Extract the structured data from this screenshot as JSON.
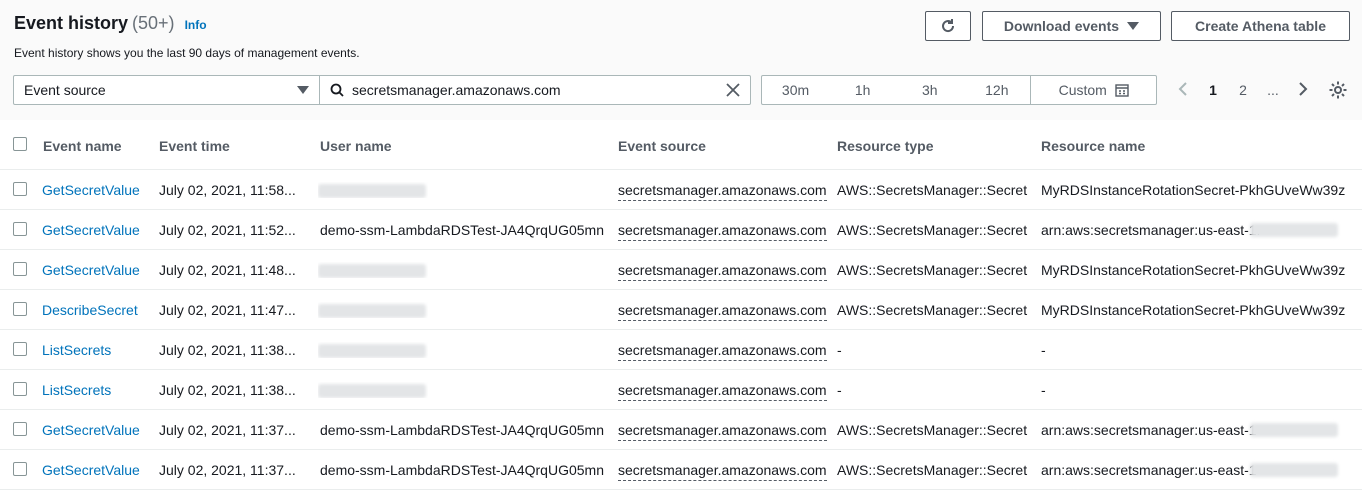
{
  "header": {
    "title": "Event history",
    "count": "(50+)",
    "info": "Info",
    "subtitle": "Event history shows you the last 90 days of management events.",
    "download_label": "Download events",
    "athena_label": "Create Athena table"
  },
  "filter": {
    "attribute": "Event source",
    "search_value": "secretsmanager.amazonaws.com"
  },
  "time_range": [
    "30m",
    "1h",
    "3h",
    "12h",
    "Custom"
  ],
  "pagination": {
    "pages": [
      "1",
      "2",
      "..."
    ],
    "current": "1"
  },
  "table": {
    "columns": [
      "Event name",
      "Event time",
      "User name",
      "Event source",
      "Resource type",
      "Resource name"
    ],
    "rows": [
      {
        "event_name": "GetSecretValue",
        "event_time": "July 02, 2021, 11:58...",
        "user_name": "",
        "event_source": "secretsmanager.amazonaws.com",
        "resource_type": "AWS::SecretsManager::Secret",
        "resource_name": "MyRDSInstanceRotationSecret-PkhGUveWw39z"
      },
      {
        "event_name": "GetSecretValue",
        "event_time": "July 02, 2021, 11:52...",
        "user_name": "demo-ssm-LambdaRDSTest-JA4QrqUG05mn",
        "event_source": "secretsmanager.amazonaws.com",
        "resource_type": "AWS::SecretsManager::Secret",
        "resource_name": "arn:aws:secretsmanager:us-east-1:"
      },
      {
        "event_name": "GetSecretValue",
        "event_time": "July 02, 2021, 11:48...",
        "user_name": "",
        "event_source": "secretsmanager.amazonaws.com",
        "resource_type": "AWS::SecretsManager::Secret",
        "resource_name": "MyRDSInstanceRotationSecret-PkhGUveWw39z"
      },
      {
        "event_name": "DescribeSecret",
        "event_time": "July 02, 2021, 11:47...",
        "user_name": "",
        "event_source": "secretsmanager.amazonaws.com",
        "resource_type": "AWS::SecretsManager::Secret",
        "resource_name": "MyRDSInstanceRotationSecret-PkhGUveWw39z"
      },
      {
        "event_name": "ListSecrets",
        "event_time": "July 02, 2021, 11:38...",
        "user_name": "",
        "event_source": "secretsmanager.amazonaws.com",
        "resource_type": "-",
        "resource_name": "-"
      },
      {
        "event_name": "ListSecrets",
        "event_time": "July 02, 2021, 11:38...",
        "user_name": "",
        "event_source": "secretsmanager.amazonaws.com",
        "resource_type": "-",
        "resource_name": "-"
      },
      {
        "event_name": "GetSecretValue",
        "event_time": "July 02, 2021, 11:37...",
        "user_name": "demo-ssm-LambdaRDSTest-JA4QrqUG05mn",
        "event_source": "secretsmanager.amazonaws.com",
        "resource_type": "AWS::SecretsManager::Secret",
        "resource_name": "arn:aws:secretsmanager:us-east-1"
      },
      {
        "event_name": "GetSecretValue",
        "event_time": "July 02, 2021, 11:37...",
        "user_name": "demo-ssm-LambdaRDSTest-JA4QrqUG05mn",
        "event_source": "secretsmanager.amazonaws.com",
        "resource_type": "AWS::SecretsManager::Secret",
        "resource_name": "arn:aws:secretsmanager:us-east-1"
      }
    ]
  },
  "colors": {
    "link": "#0073bb",
    "text": "#16191f",
    "muted": "#545b64",
    "border": "#aab7b8"
  }
}
